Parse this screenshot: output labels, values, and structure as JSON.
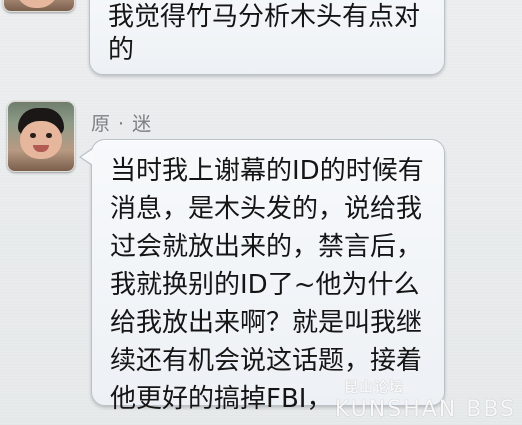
{
  "messages": [
    {
      "lines": [
        "我觉得竹马分析木头有点对",
        "的"
      ]
    },
    {
      "sender": "原 · 迷",
      "lines": [
        "当时我上谢幕的ID的时候有",
        "消息，是木头发的，说给我",
        "过会就放出来的，禁言后，",
        "我就换别的ID了~他为什么",
        "给我放出来啊？就是叫我继",
        "续还有机会说这话题，接着",
        "他更好的搞掉FBI，"
      ]
    }
  ],
  "watermark": {
    "top": "昆山论坛",
    "bottom": "KUNSHAN BBS"
  }
}
